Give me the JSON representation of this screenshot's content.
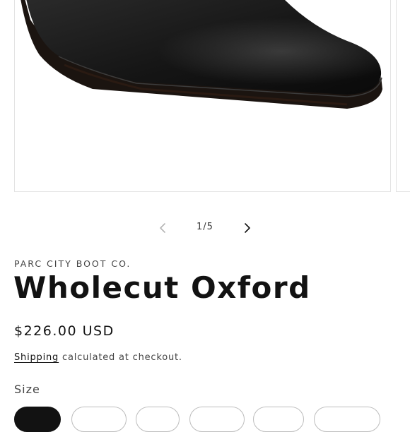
{
  "gallery": {
    "counter": "1/5",
    "prev_icon": "chevron-left-icon",
    "next_icon": "chevron-right-icon"
  },
  "product": {
    "vendor": "PARC CITY BOOT CO.",
    "title": "Wholecut Oxford",
    "price": "$226.00 USD",
    "shipping_link": "Shipping",
    "shipping_text": " calculated at checkout."
  },
  "size": {
    "label": "Size",
    "selected_index": 0
  },
  "colors": {
    "text": "#121212",
    "muted": "#444444",
    "border": "#e3e3e3"
  }
}
